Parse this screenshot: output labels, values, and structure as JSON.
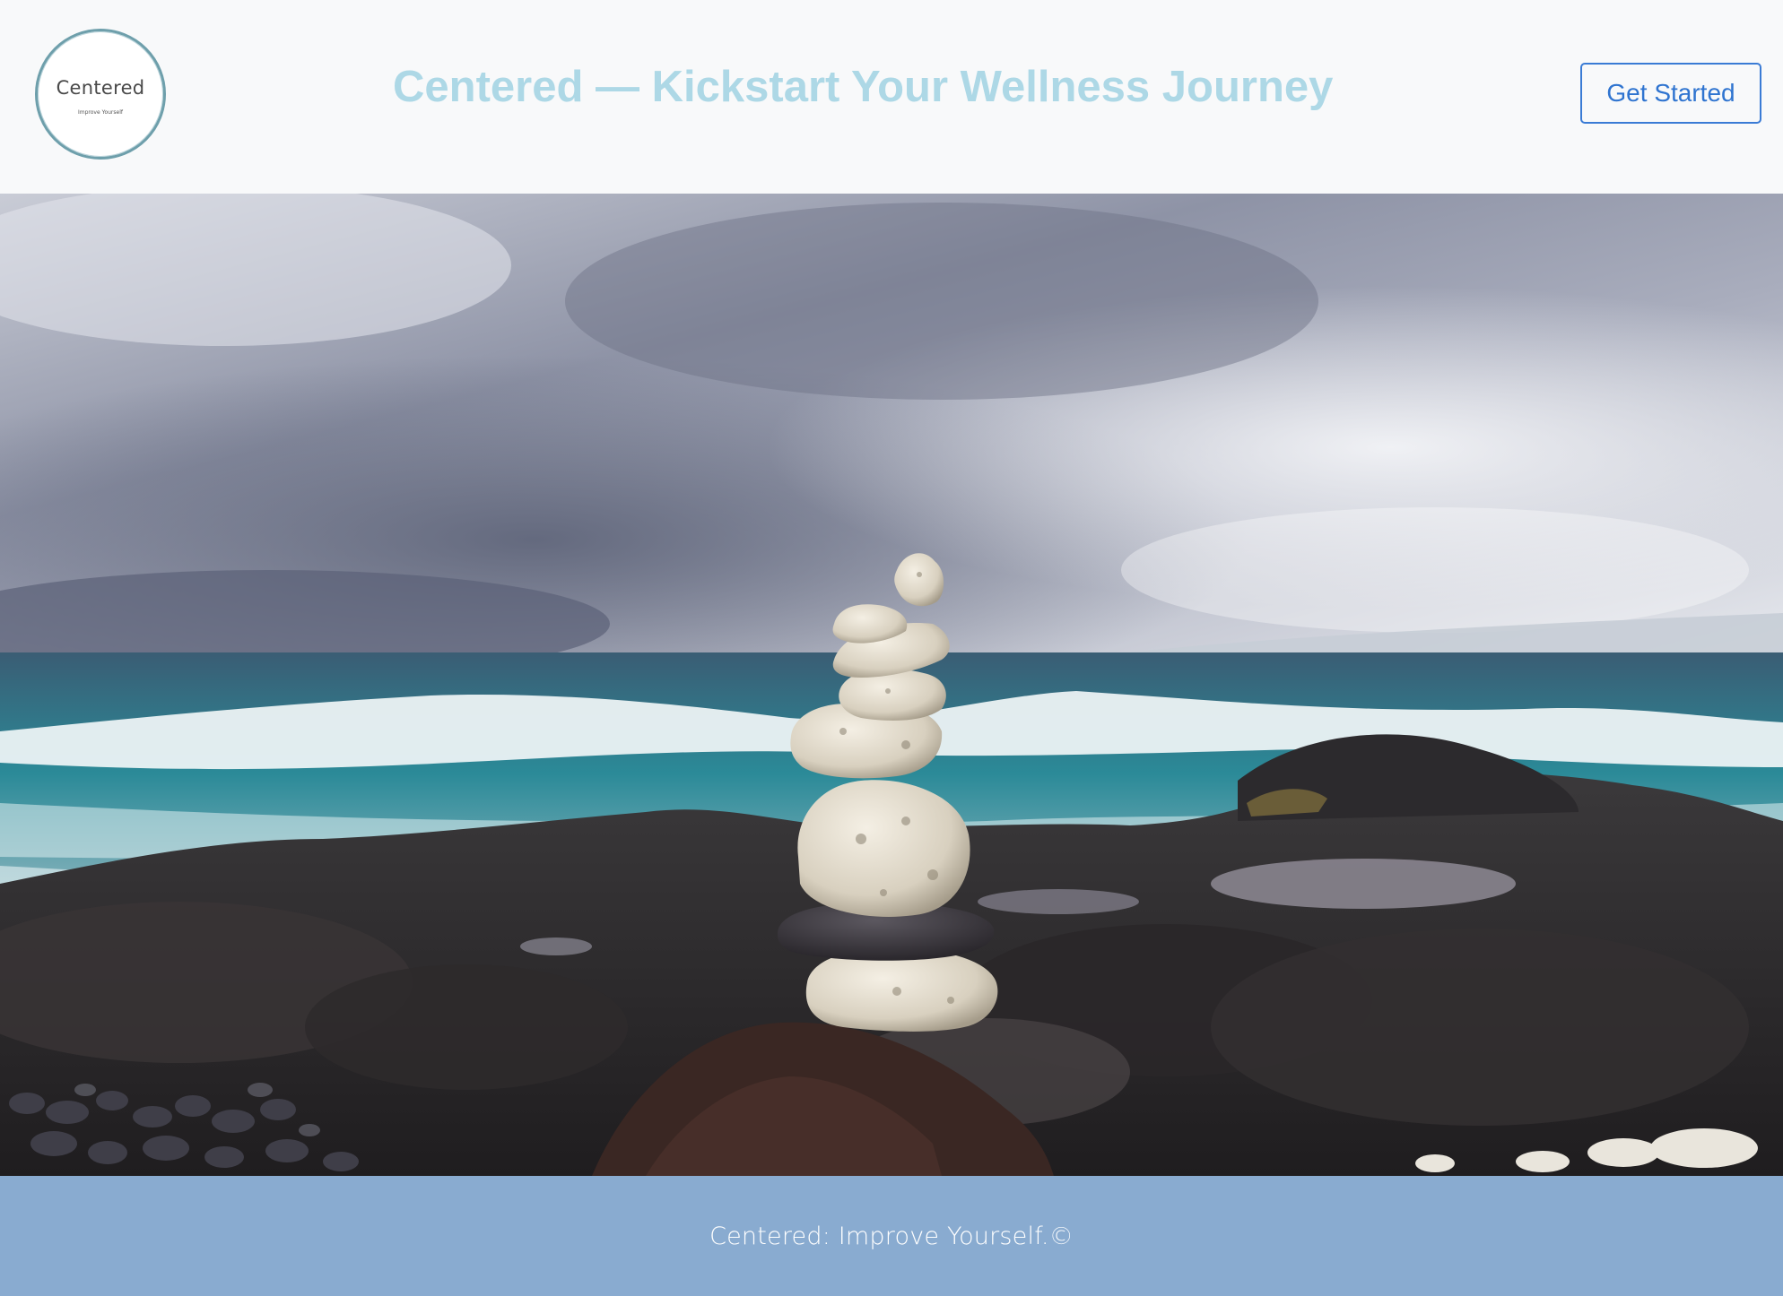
{
  "header": {
    "logo": {
      "name": "Centered",
      "tagline": "Improve Yourself"
    },
    "title": "Centered — Kickstart Your Wellness Journey",
    "cta_label": "Get Started"
  },
  "hero": {
    "image_alt": "hero-stone-cairn-beach-photo"
  },
  "footer": {
    "text": "Centered: Improve Yourself.©"
  },
  "colors": {
    "header_bg": "#f8f9fa",
    "title": "#add8e6",
    "cta_border": "#3a7bd5",
    "footer_bg": "#89abd0",
    "footer_text": "#ffffff"
  }
}
